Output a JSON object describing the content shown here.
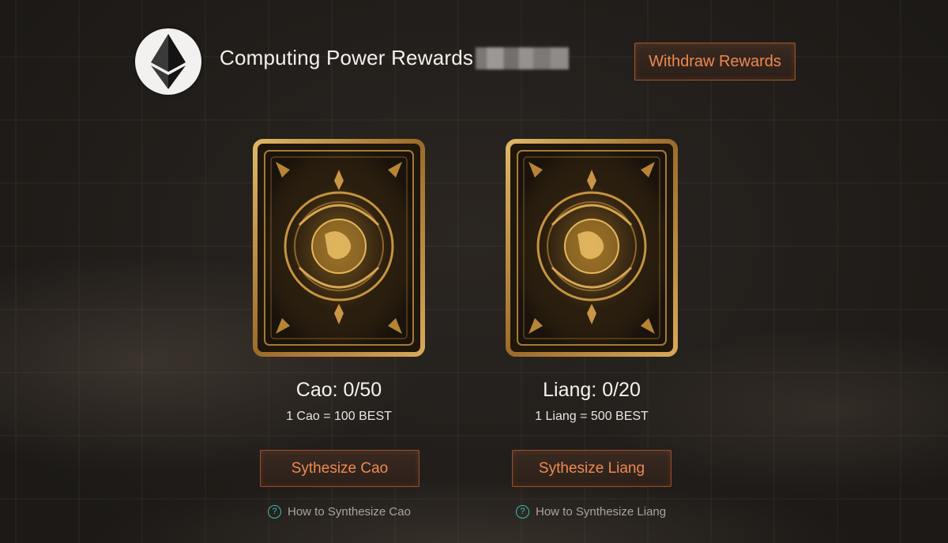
{
  "header": {
    "logo_icon": "ethereum-icon",
    "title": "Computing Power Rewards",
    "withdraw_label": "Withdraw Rewards"
  },
  "cards": [
    {
      "count": "Cao: 0/50",
      "rate": "1 Cao = 100 BEST",
      "synth_label": "Sythesize Cao",
      "help_label": "How to Synthesize Cao"
    },
    {
      "count": "Liang: 0/20",
      "rate": "1 Liang = 500 BEST",
      "synth_label": "Sythesize Liang",
      "help_label": "How to Synthesize Liang"
    }
  ],
  "colors": {
    "accent": "#f0884f",
    "button_border": "#a8562f",
    "help_icon": "#3dbdb4",
    "card_gold": "#c79a45"
  }
}
